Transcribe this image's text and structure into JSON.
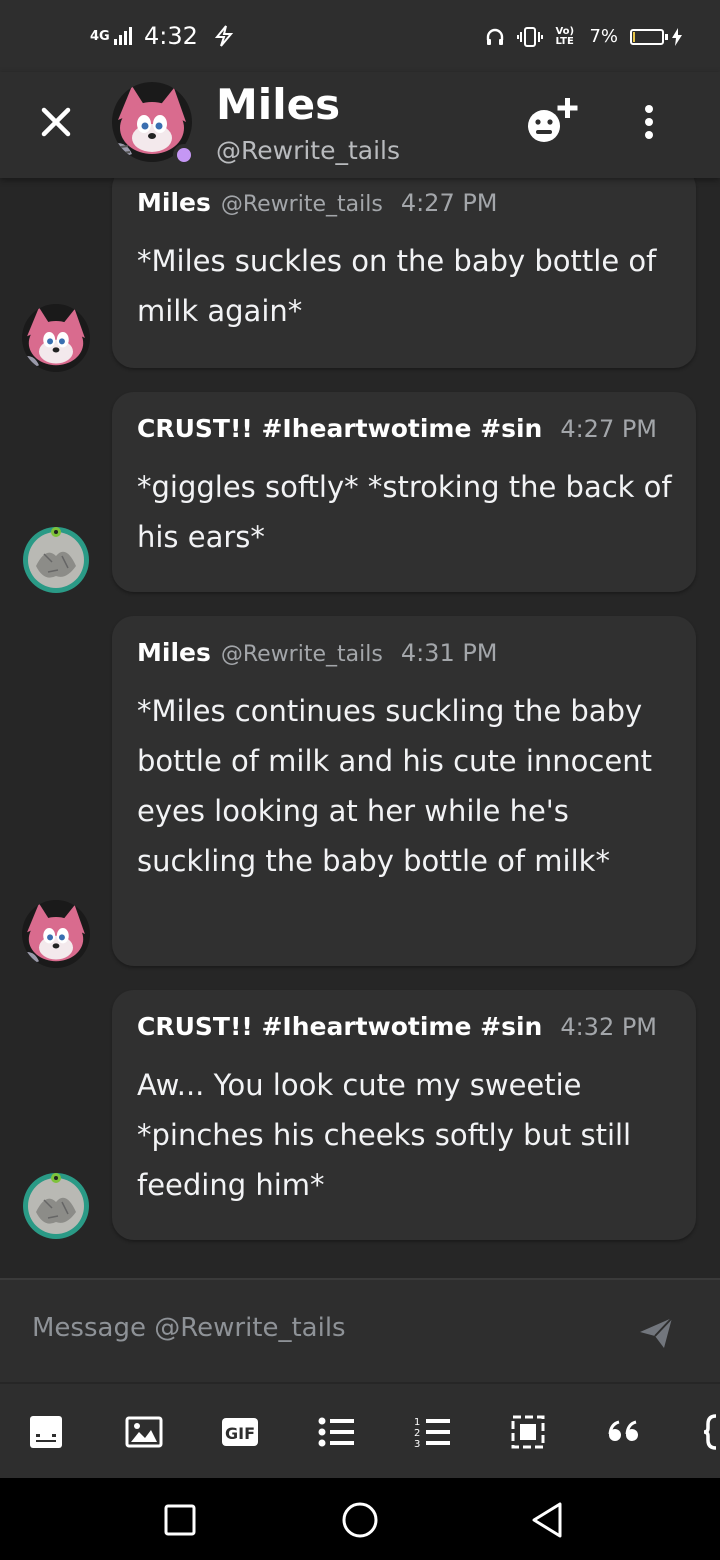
{
  "status_bar": {
    "network": "4G",
    "time": "4:32",
    "volte": "Vo) LTE",
    "battery_text": "7%",
    "battery_level": 0.07
  },
  "header": {
    "name": "Miles",
    "handle": "@Rewrite_tails"
  },
  "messages": [
    {
      "author": "Miles",
      "handle": "@Rewrite_tails",
      "time": "4:27 PM",
      "text": "*Miles suckles on the baby bottle of milk again*",
      "avatar": "tails-avatar"
    },
    {
      "author": "CRUST!! #Iheartwotime #sin",
      "handle": "",
      "time": "4:27 PM",
      "text": "*giggles softly* *stroking the back of his ears*",
      "avatar": "crust-avatar"
    },
    {
      "author": "Miles",
      "handle": "@Rewrite_tails",
      "time": "4:31 PM",
      "text": "*Miles continues suckling the baby bottle of milk and his cute innocent eyes looking at her while he's suckling the baby bottle of milk*",
      "avatar": "tails-avatar"
    },
    {
      "author": "CRUST!! #Iheartwotime #sin",
      "handle": "",
      "time": "4:32 PM",
      "text": "Aw... You look cute my sweetie *pinches his cheeks softly but still feeding him*",
      "avatar": "crust-avatar"
    }
  ],
  "input": {
    "placeholder": "Message @Rewrite_tails"
  },
  "toolbar": {
    "items": [
      "sticker-icon",
      "image-icon",
      "gif-icon",
      "bullet-list-icon",
      "numbered-list-icon",
      "spoiler-icon",
      "quote-icon",
      "code-icon"
    ]
  },
  "colors": {
    "background": "#262626",
    "bubble": "#303030",
    "header": "#2e2e2e",
    "presence": "#c597f4",
    "muted_text": "#a3a6aa"
  }
}
